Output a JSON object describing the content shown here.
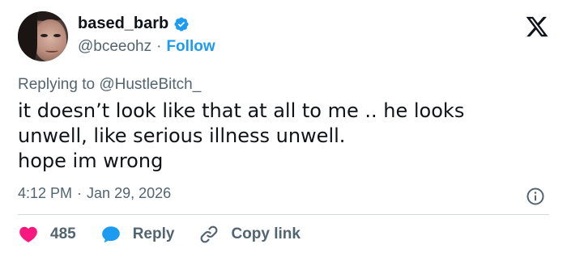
{
  "tweet": {
    "author": {
      "display_name": "based_barb",
      "handle": "@bceeohz",
      "verified": true
    },
    "follow_label": "Follow",
    "separator": "·",
    "replying_to_prefix": "Replying to ",
    "replying_to_handle": "@HustleBitch_",
    "text_lines": [
      "it doesn’t look like that at all to me .. he looks",
      "unwell, like serious illness unwell.",
      "hope im wrong"
    ],
    "time": "4:12 PM",
    "date": "Jan 29, 2026",
    "likes_count": "485",
    "reply_label": "Reply",
    "copy_link_label": "Copy link"
  },
  "colors": {
    "accent": "#1d9bf0",
    "like": "#f91880",
    "text": "#0f1419",
    "muted": "#536471",
    "divider": "#cfd9de"
  },
  "icons": [
    "verified-badge-icon",
    "x-logo-icon",
    "info-icon",
    "heart-icon",
    "speech-bubble-icon",
    "link-icon"
  ]
}
